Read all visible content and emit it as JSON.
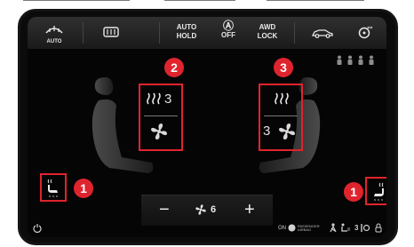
{
  "topbar": {
    "defrost_front_label": "AUTO",
    "auto_hold": {
      "line1": "AUTO",
      "line2": "HOLD"
    },
    "off": {
      "line2": "OFF"
    },
    "awd_lock": {
      "line1": "AWD",
      "line2": "LOCK"
    }
  },
  "center": {
    "left_heat_level": "3",
    "right_fan_level": "3"
  },
  "bottom": {
    "minus": "−",
    "fan_speed": "6",
    "plus": "+"
  },
  "status": {
    "on_label": "ON",
    "passenger_airbag": "PASSENGER AIRBAG",
    "level": "3"
  },
  "badges": {
    "one": "1",
    "two": "2",
    "three": "3"
  },
  "colors": {
    "accent_red": "#e0242d",
    "screen_bg": "#050505"
  }
}
